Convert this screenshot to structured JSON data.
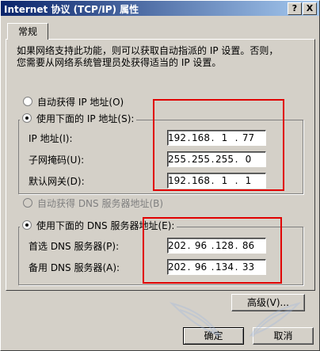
{
  "window": {
    "title": "Internet 协议 (TCP/IP) 属性",
    "help_button": "?",
    "close_button": "X"
  },
  "tabs": [
    {
      "label": "常规"
    }
  ],
  "intro": {
    "line1": "如果网络支持此功能，则可以获取自动指派的 IP 设置。否则，",
    "line2": "您需要从网络系统管理员处获得适当的 IP 设置。"
  },
  "ip_section": {
    "auto_label": "自动获得 IP 地址(O)",
    "manual_label": "使用下面的 IP 地址(S):",
    "selected": "manual",
    "fields": [
      {
        "label": "IP 地址(I):",
        "octets": [
          "192",
          "168",
          "1",
          "77"
        ]
      },
      {
        "label": "子网掩码(U):",
        "octets": [
          "255",
          "255",
          "255",
          "0"
        ]
      },
      {
        "label": "默认网关(D):",
        "octets": [
          "192",
          "168",
          "1",
          "1"
        ]
      }
    ]
  },
  "dns_section": {
    "auto_label": "自动获得 DNS 服务器地址(B)",
    "manual_label": "使用下面的 DNS 服务器地址(E):",
    "selected": "manual",
    "fields": [
      {
        "label": "首选 DNS 服务器(P):",
        "octets": [
          "202",
          "96",
          "128",
          "86"
        ]
      },
      {
        "label": "备用 DNS 服务器(A):",
        "octets": [
          "202",
          "96",
          "134",
          "33"
        ]
      }
    ]
  },
  "buttons": {
    "advanced": "高级(V)...",
    "ok": "确定",
    "cancel": "取消"
  },
  "colors": {
    "dialog_bg": "#d4d0c8",
    "titlebar_start": "#0a246a",
    "titlebar_end": "#a6caf0",
    "highlight_box": "#e00000"
  }
}
